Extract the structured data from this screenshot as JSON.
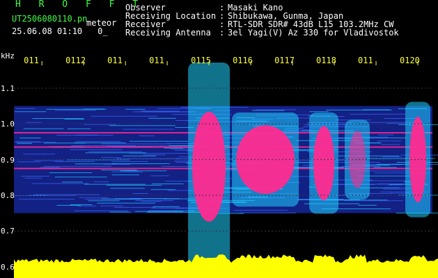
{
  "header": {
    "brand": "H R O F F T",
    "file_name": "UT2506080110.pn",
    "file_suffix": "meteor",
    "timestamp": "25.06.08 01:10",
    "timestamp_extra": "0_",
    "fields": [
      {
        "label": "Observer",
        "value": "Masaki Kano"
      },
      {
        "label": "Receiving Location",
        "value": "Shibukawa, Gunma, Japan"
      },
      {
        "label": "Receiver",
        "value": "RTL-SDR SDR# 43dB L15 103.2MHz CW"
      },
      {
        "label": "Receiving Antenna",
        "value": "3el Yagi(V) Az 330 for Vladivostok"
      }
    ],
    "colon": ":"
  },
  "chart_data": {
    "type": "heatmap",
    "title": "",
    "ylabel": "kHz",
    "ylim": [
      0.58,
      1.16
    ],
    "yticks": [
      "1.1",
      "1.0",
      "0.9",
      "0.8",
      "0.7",
      "0.6"
    ],
    "xticks": [
      "011",
      "0112",
      "011",
      "011",
      "0115",
      "0116",
      "0117",
      "0118",
      "011",
      "0120"
    ],
    "x_minutes": [
      1.1,
      1.2,
      1.3,
      1.4,
      1.5,
      1.6,
      1.7,
      1.8,
      1.9,
      2.0
    ],
    "background_band_khz": [
      0.75,
      1.05
    ],
    "persistent_carriers_khz": [
      0.875,
      0.935,
      0.975
    ],
    "meteor_bursts": [
      {
        "start_min": 1.46,
        "end_min": 1.54,
        "fmin_khz": 0.6,
        "fmax_khz": 1.16,
        "intensity": "strong"
      },
      {
        "start_min": 1.565,
        "end_min": 1.705,
        "fmin_khz": 0.78,
        "fmax_khz": 1.02,
        "intensity": "medium"
      },
      {
        "start_min": 1.75,
        "end_min": 1.8,
        "fmin_khz": 0.76,
        "fmax_khz": 1.02,
        "intensity": "medium"
      },
      {
        "start_min": 1.835,
        "end_min": 1.875,
        "fmin_khz": 0.8,
        "fmax_khz": 1.0,
        "intensity": "weak"
      },
      {
        "start_min": 1.98,
        "end_min": 2.02,
        "fmin_khz": 0.75,
        "fmax_khz": 1.05,
        "intensity": "medium"
      }
    ],
    "colors": {
      "background": "#000000",
      "noise": "#1a2bb0",
      "mid": "#1fd0ff",
      "hot": "#ff2a90",
      "power_trace": "#ffff00",
      "tick_text": "#ffff40",
      "label_text": "#ffffff"
    }
  }
}
